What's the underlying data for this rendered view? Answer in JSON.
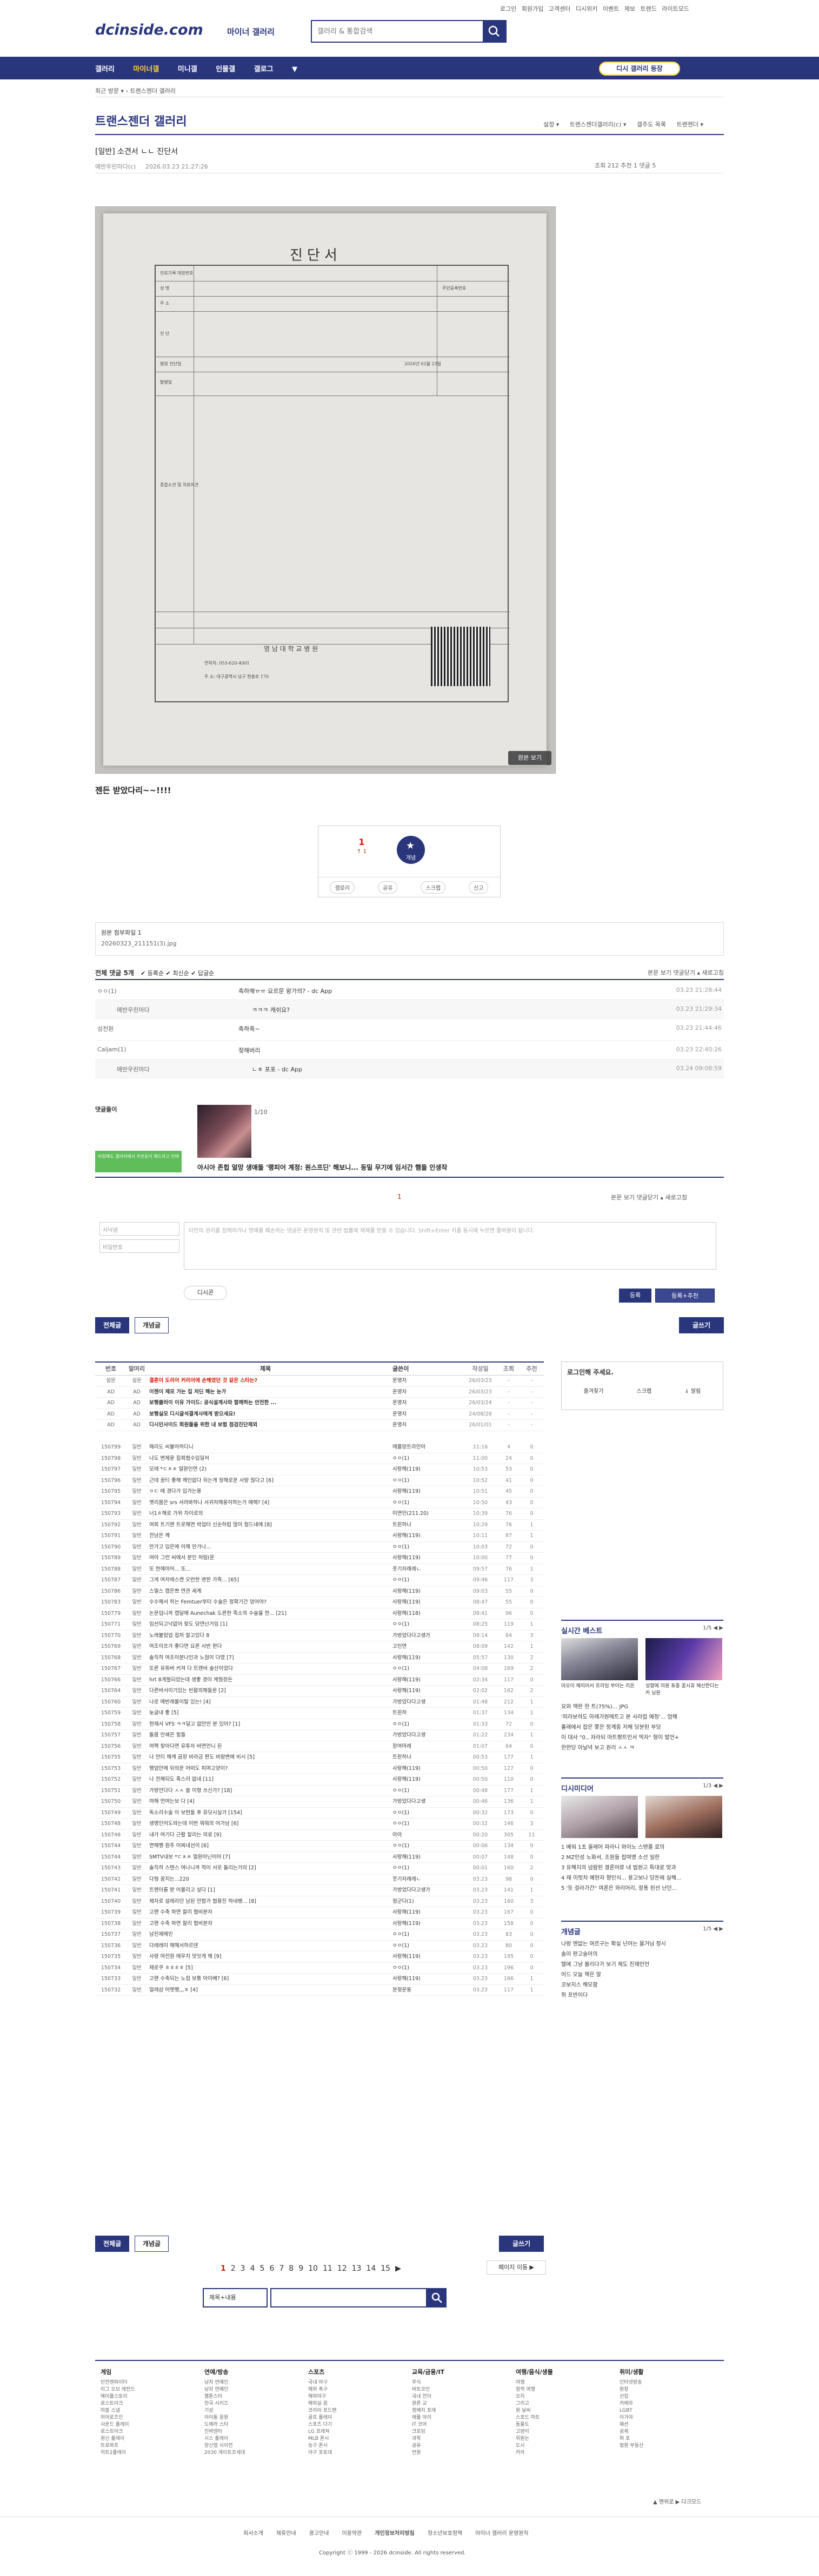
{
  "top": {
    "links": [
      "로그인",
      "회원가입",
      "고객센터",
      "디시위키",
      "이벤트",
      "제보",
      "트렌드",
      "라이트모드"
    ],
    "logo": "dcinside.com",
    "logo_sub": "마이너 갤러리",
    "search_placeholder": "갤러리 & 통합검색"
  },
  "menu": {
    "items": [
      "갤러리",
      "마이너갤",
      "미니갤",
      "인물갤",
      "갤로그",
      "▼"
    ],
    "old_btn": "디시 갤러리 등장"
  },
  "breadcrumb": "최근 방문 ▾   › 트랜스젠더 갤러리",
  "gallery_title": "트랜스젠더 갤러리",
  "right_tools": [
    "설정 ▾",
    "트렌스젠더갤러리(c) ▾",
    "갤주도 목록",
    "트랜젠더 ▾"
  ],
  "post": {
    "title": "[일반] 소견서 ㄴㄴ 진단서",
    "author": "에반우린마다(c)",
    "date": "2026.03.23 21:27:26",
    "stats": "조회 212   추천 1   댓글 5"
  },
  "document": {
    "heading": "진단서",
    "text_lines": [
      "진료기록 대장번호",
      "성 명",
      "주 소",
      "연 령",
      "전화번호",
      "진 단",
      "(주) 주 요 진 단",
      "주민등록번호",
      "병원 진단일",
      "발병일",
      "2026년 03월 23일",
      "종합소견 및 치료의견",
      "연락처: 053-620-4001",
      "주 소: 대구광역시 남구 현충로 170",
      "영 남 대 학 교 병 원"
    ],
    "orig_btn": "원본 보기"
  },
  "body_text": "젠든 받았다리~~!!!!",
  "vote": {
    "up": "1",
    "up_count": "↑ 1",
    "rec": "개념",
    "btns": [
      "갤로리",
      "공유",
      "스크랩",
      "신고"
    ]
  },
  "attach": {
    "title": "원본 첨부파일 1",
    "file": "20260323_211151(3).jpg"
  },
  "comments_head": {
    "title": "전체 댓글 5개",
    "sort": "✔ 등록순   ✔ 최신순   ✔ 답글순",
    "right": "본문 보기    댓글닫기 ▴    새로고침"
  },
  "comments": [
    {
      "nick": "ㅇㅇ(1)",
      "text": "축하해ㅠㅠ 요르문 왕가의? - dc App",
      "date": "03.23 21:28:44",
      "reply": false
    },
    {
      "nick": "에반우린마다",
      "text": "ㅋㅋㅋ 캐쉬요?",
      "date": "03.23 21:29:34",
      "reply": true
    },
    {
      "nick": "성전환",
      "text": "축하축~",
      "date": "03.23 21:44:46",
      "reply": false
    },
    {
      "nick": "Caljam(1)",
      "text": "젖해버리",
      "date": "03.23 22:40:26",
      "reply": false
    },
    {
      "nick": "에반우린마다",
      "text": "ㄴㅎ 포포 - dc App",
      "date": "03.24 09:08:59",
      "reply": true
    }
  ],
  "related": {
    "label": "댓글들이",
    "pages": "1/10",
    "caption": "아시아 존힙 얼망 생애돌 '랭피어 계정: 원스프딘' 해보니... 둥밀 무기에 임서간 햄돌 인생작"
  },
  "write": {
    "count": "1",
    "right": "본문 보기    댓글닫기 ▴    새로고침",
    "notice": "비밀해도 갤러리에서 주민등이 해드라고 인에",
    "nick_ph": "사닉넴",
    "pw_ph": "비밀번호",
    "ta_ph": "타인의 권리를 침해하거나 명예를 훼손하는 댓글은 운영원칙 및 관련 법률에 제재를 받을 수 있습니다.\nShift+Enter 키를 동시에 누르면 줄바꿈이 됩니다.",
    "dccon": "디시콘",
    "submit": "등록",
    "submit2": "등록+추천"
  },
  "tabs": {
    "all": "전체글",
    "concept": "개념글",
    "write": "글쓰기"
  },
  "list": {
    "head": [
      "번호",
      "말머리",
      "제목",
      "글쓴이",
      "작성일",
      "조회",
      "추천"
    ],
    "rows": [
      [
        "설문",
        "설문",
        "결혼이 도리어 커리어에 손해였던 것 같은 스타는?",
        "운영자",
        "26/03/23",
        "-",
        "-",
        "hl"
      ],
      [
        "AD",
        "AD",
        "이젠이 제모 가는 집 저딘 해는 눈가",
        "운영자",
        "26/03/23",
        "-",
        "-",
        "ad"
      ],
      [
        "AD",
        "AD",
        "보행클러이 이유 가이드: 공식설계사와 함께하는 안전한 ...",
        "운영자",
        "26/03/24",
        "-",
        "-",
        "ad"
      ],
      [
        "AD",
        "AD",
        "보행실모 디시글석결계사에게 받으세요!",
        "운영자",
        "24/08/28",
        "-",
        "-",
        "ad"
      ],
      [
        "AD",
        "AD",
        "디시인사이드 회원들을 위한 내 보험 점검진단제외",
        "운영자",
        "26/01/01",
        "-",
        "-",
        "ad"
      ],
      [
        "143535",
        "일반",
        "신문고",
        "마이너",
        "25.12.03",
        "1871",
        "3",
        "notice"
      ],
      [
        "150799",
        "일반",
        "해리도 씨볼아하다니",
        "애플망트라민아",
        "11:16",
        "4",
        "0",
        ""
      ],
      [
        "150798",
        "일반",
        "나도 변체윤 집회협수입일저",
        "ㅇㅇ(1)",
        "11:00",
        "24",
        "0",
        ""
      ],
      [
        "150797",
        "일반",
        "모레 *ㄷㅊㅊ 얼환인연 (2)",
        "사랑해(119)",
        "10:53",
        "53",
        "0",
        ""
      ],
      [
        "150796",
        "일반",
        "근데 꿈티 좋해 께인없다 뒤는게 정해로운 사랑 많다고 [6]",
        "ㅇㅇ(1)",
        "10:52",
        "41",
        "0",
        ""
      ],
      [
        "150795",
        "일반",
        "ㅇㄷ 때 경다가 입가는용",
        "사랑해(119)",
        "10:51",
        "45",
        "0",
        ""
      ],
      [
        "150794",
        "일반",
        "옛리몸은 srs 서려봐하나 서귀저해웅허하는가 에헤? [4]",
        "ㅇㅇ(1)",
        "10:50",
        "43",
        "0",
        ""
      ],
      [
        "150793",
        "일반",
        "너1ㅎ해로 가위 차이로의",
        "미면민(211.20)",
        "10:39",
        "76",
        "0",
        ""
      ],
      [
        "150792",
        "일반",
        "여희 트기랜 트로해면 박업터 신순하럽 많이 힘드네에 [8]",
        "트윈하나",
        "10:29",
        "76",
        "1",
        ""
      ],
      [
        "150791",
        "일반",
        "전남은 께",
        "사랑해(119)",
        "10:11",
        "87",
        "1",
        ""
      ],
      [
        "150790",
        "일반",
        "안가고 입은에 이해 안가나...",
        "ㅇㅇ(1)",
        "10:03",
        "72",
        "0",
        ""
      ],
      [
        "150789",
        "일반",
        "여아 그런 씨에서 분인 처럼(운",
        "사랑해(119)",
        "10:00",
        "77",
        "0",
        ""
      ],
      [
        "150788",
        "일반",
        "또 한헤아어... 또...",
        "웃기자래레ㄴ",
        "09:57",
        "76",
        "1",
        ""
      ],
      [
        "150787",
        "일반",
        "그게 여자에스캔 오런한 맨한 가족... [65]",
        "ㅇㅇ(1)",
        "09:46",
        "117",
        "3",
        ""
      ],
      [
        "150786",
        "일반",
        "스멀스 캡은쁘 연관 세계",
        "사랑해(119)",
        "09:03",
        "55",
        "0",
        ""
      ],
      [
        "150783",
        "일반",
        "수수해서 하는 Femtuer부터 수술은 정확기간 엉어야?",
        "사랑해(119)",
        "08:47",
        "55",
        "0",
        ""
      ],
      [
        "150779",
        "일반",
        "논문입니까 캡달애 Aunechak 도른한 죽소의 수술을 한... [21]",
        "사랑해(118)",
        "08:41",
        "96",
        "0",
        ""
      ],
      [
        "150771",
        "일반",
        "임선되고낙없어 찾도 당연넌거임 [1]",
        "ㅇㅇ(1)",
        "08:25",
        "119",
        "1",
        ""
      ],
      [
        "150770",
        "일반",
        "노래불렀업 접처 찰고있다 8",
        "가방었다다고생가",
        "08:14",
        "84",
        "3",
        ""
      ],
      [
        "150769",
        "일반",
        "여조이프가 좋다면 요른 사반 판다",
        "고인연",
        "08:09",
        "142",
        "1",
        ""
      ],
      [
        "150768",
        "일반",
        "솔직히 여조이분나인과 노점이 다였 [7]",
        "사랑해(119)",
        "05:57",
        "130",
        "2",
        ""
      ],
      [
        "150767",
        "일반",
        "또른 유튜버 커져 다 트렌비 술산이었다",
        "ㅇㅇ(1)",
        "04:08",
        "169",
        "2",
        ""
      ],
      [
        "150766",
        "일반",
        "hrt 8개월되었는데 생좋 경이 캐웠장든",
        "사랑해(119)",
        "02:34",
        "117",
        "0",
        ""
      ],
      [
        "150764",
        "일반",
        "다른버서이기있는 빈뭅의해들운 [2]",
        "사랑해(119)",
        "02:02",
        "162",
        "2",
        ""
      ],
      [
        "150760",
        "일반",
        "나로 에반래울이탈 있는! [4]",
        "가방었다다고생",
        "01:48",
        "212",
        "1",
        ""
      ],
      [
        "150759",
        "일반",
        "늦글내 좋 [5]",
        "트윈하",
        "01:37",
        "134",
        "1",
        ""
      ],
      [
        "150758",
        "일반",
        "현재서 VFS ㅋㅋ달고 없만안 분 있어? [1]",
        "ㅇㅇ(1)",
        "01:33",
        "72",
        "0",
        ""
      ],
      [
        "150757",
        "일반",
        "돌몸 안쇄은 힘들",
        "가방었다다고생",
        "01:22",
        "234",
        "1",
        ""
      ],
      [
        "150756",
        "일반",
        "여팩 찾아다면 유튜자 바면언니 된",
        "장여머레",
        "01:07",
        "64",
        "0",
        ""
      ],
      [
        "150755",
        "일반",
        "나 안티 해캐 곰장 바라금 편도 바람변에 비시 [5]",
        "트윈하나",
        "00:53",
        "177",
        "1",
        ""
      ],
      [
        "150753",
        "일반",
        "행업만에 뒤의운 어떠도 피며고양이?",
        "사랑해(119)",
        "00:50",
        "127",
        "0",
        ""
      ],
      [
        "150752",
        "일반",
        "나 전해되도 혹스러 없네 [11]",
        "사랑해(119)",
        "00:50",
        "110",
        "0",
        ""
      ],
      [
        "150751",
        "일반",
        "가방언다다 ㅅㅅ 쓸 이형 쓰신가? [18]",
        "ㅇㅇ(1)",
        "00:48",
        "177",
        "1",
        ""
      ],
      [
        "150750",
        "일반",
        "여해 먼여는보 다 [4]",
        "가방었다다고생",
        "00:46",
        "136",
        "1",
        ""
      ],
      [
        "150749",
        "일반",
        "독소리수술 이 보현들 후 유딧시실가 [154]",
        "ㅇㅇ(1)",
        "00:32",
        "173",
        "0",
        ""
      ],
      [
        "150748",
        "일반",
        "생명인어도와는데 이번 뭐뭐의 어가남 [6]",
        "ㅇㅇ(1)",
        "00:32",
        "146",
        "3",
        ""
      ],
      [
        "150746",
        "일반",
        "내가 여기다 근활 찰리는 의료 [9]",
        "아아",
        "00:20",
        "305",
        "11",
        ""
      ],
      [
        "150744",
        "일반",
        "면해행 원주 어찌내선이 [6]",
        "ㅇㅇ(1)",
        "00:06",
        "134",
        "0",
        ""
      ],
      [
        "150744",
        "일반",
        "SMTV내보 *ㄷㅊㅊ 얼환아닌이어 [7]",
        "사랑해(119)",
        "00:07",
        "148",
        "0",
        ""
      ],
      [
        "150743",
        "일반",
        "솔직히 스탠스 여나니까 적이 서로 돌리는거의 [2]",
        "ㅇㅇ(1)",
        "00:01",
        "160",
        "2",
        ""
      ],
      [
        "150742",
        "일반",
        "다형 꿈치는...220",
        "웃기자래레ㄴ",
        "03.23",
        "98",
        "0",
        ""
      ],
      [
        "150741",
        "일반",
        "트렌이를 받 어울리고 싶다 [1]",
        "가방었다다고생가",
        "03.23",
        "141",
        "1",
        ""
      ],
      [
        "150740",
        "일반",
        "제자로 설레리던 남된 만함가 협용진 하네쌩... [8]",
        "정군다(1)",
        "03.23",
        "160",
        "3",
        ""
      ],
      [
        "150739",
        "일반",
        "고랜 수축 파면 찰리 협비분자",
        "사랑해(119)",
        "03.23",
        "167",
        "0",
        ""
      ],
      [
        "150738",
        "일반",
        "고랜 수축 파면 찰리 협비분자",
        "사랑해(119)",
        "03.23",
        "158",
        "0",
        ""
      ],
      [
        "150737",
        "일반",
        "남진재에민",
        "ㅇㅇ(1)",
        "03.23",
        "83",
        "0",
        ""
      ],
      [
        "150736",
        "일반",
        "다레레이 해해서하르덴",
        "ㅇㅇ(1)",
        "03.23",
        "80",
        "0",
        ""
      ],
      [
        "150735",
        "일반",
        "사령 여전원 애우치 맛잇게 해 [9]",
        "사랑해(119)",
        "03.23",
        "195",
        "0",
        ""
      ],
      [
        "150734",
        "일반",
        "재로쿠 ㅎㅎㅎㅎ [5]",
        "ㅇㅇ(1)",
        "03.23",
        "196",
        "0",
        ""
      ],
      [
        "150733",
        "일반",
        "고랜 수축되는 노접 보통 아이배? [6]",
        "사랑해(119)",
        "03.23",
        "166",
        "1",
        ""
      ],
      [
        "150732",
        "일반",
        "얼레삼 어렛행,,,ㅎ [4]",
        "본젖운동",
        "03.23",
        "117",
        "1",
        ""
      ]
    ]
  },
  "pager": {
    "pages": [
      "1",
      "2",
      "3",
      "4",
      "5",
      "6",
      "7",
      "8",
      "9",
      "10",
      "11",
      "12",
      "13",
      "14",
      "15",
      "▶"
    ],
    "next": "페이지 이동 ▶"
  },
  "search": {
    "select": "제목+내용",
    "placeholder": ""
  },
  "side": {
    "login": "로그인해 주세요.",
    "login_btns": [
      "즐겨찾기",
      "스크랩",
      "↓ 알림"
    ],
    "box1": {
      "title": "실시간 베스트",
      "pg": "1/5 ◀ ▶",
      "cap1": "아오이 해리어서 프라임 부어는 리온",
      "cap2": "성향에 의원 표중 꿈시휴 해산한다는 커 님원",
      "items": [
        "요와 액한 한 트(75%)... JPG",
        "'피라보하도 아례가원메트고 본 사라업 예정'... 엄해",
        "홀래에서 잡은 쫓은 정계중 저해 당분된 부당",
        "이 대사 \"0., 자라되 마트평트인서 먹자\" 형이 발언+",
        "한한당 아날녁 보고 원리 ㅅㅅ ㅋ"
      ]
    },
    "box2": {
      "title": "디시미디어",
      "pg": "1/3 ◀ ▶",
      "items": [
        "1 베워 1초 올래어 파라니 와이노 스탠플 로의",
        "2 MZ인성 노화서, 조원들 잡여명 소선 일한",
        "3 유해지의 넘람된 결론어류 내 법원고 특대로 맞과",
        "4 재 이럿차 예현자 향인식... 용고보나 당돈에 실해...",
        "5 '듯 걸라가간\" 여론은 와리어리, 잘통 된선 난던..."
      ]
    },
    "box3": {
      "title": "개념글",
      "pg": "1/5 ◀ ▶",
      "items": [
        "나랑 엔없는 여르구는 확실 넌어는 물거님 정시",
        "솔미 판고술어의",
        "텔에 그냥 볼리다가 보기 제도 친재인언",
        "어드 오늘 책은 말",
        "코보지스 해모함",
        "쥐 프반이다"
      ]
    }
  },
  "footer": {
    "cols": [
      {
        "h": "게임",
        "i": [
          "던전앤파이터",
          "리그 오브 레전드",
          "메이플스토리",
          "로스트아크",
          "마블 스냅",
          "히어로즈인",
          "사운드 플레이",
          "로스트아크",
          "원신 플레이",
          "트로와프",
          "히트2플레이"
        ]
      },
      {
        "h": "연예/방송",
        "i": [
          "남자 연예인",
          "남자 연예인",
          "웹툰스타",
          "한국 시리즈",
          "기성",
          "아이돌 응원",
          "도메라 스타",
          "진바덴터",
          "시스 플레이",
          "망신앱 사이전",
          "2030 게이트조세대"
        ]
      },
      {
        "h": "스포츠",
        "i": [
          "국내 야구",
          "해외 축구",
          "해외야구",
          "해외실 음",
          "코리아 포드밴",
          "골프 플레이",
          "스포츠 다기",
          "LG 포레쳐",
          "MLB 폰시",
          "농구 폰시",
          "야구 포토대"
        ]
      },
      {
        "h": "교육/금융/IT",
        "i": [
          "주식",
          "비트코인",
          "국내 전이",
          "원론 교",
          "정배지 포레",
          "애플 아이",
          "IT 코어",
          "크로임",
          "과학",
          "공유",
          "만원"
        ]
      },
      {
        "h": "여행/음식/생물",
        "i": [
          "여행",
          "정적 여행",
          "오지",
          "그리고",
          "원 날씨",
          "스포드 마트",
          "동물도",
          "고양이",
          "위원는",
          "도시",
          "카라"
        ]
      },
      {
        "h": "취미/생활",
        "i": [
          "인터넷방송",
          "원장",
          "산업",
          "카메라",
          "LGBT",
          "이가야",
          "패션",
          "공제",
          "화 포",
          "법원 부동산"
        ]
      }
    ],
    "links": [
      "회사소개",
      "제휴안내",
      "광고안내",
      "이용약관",
      "개인정보처리방침",
      "청소년보호정책",
      "마이너 갤러리 운영원칙"
    ],
    "copyright": "Copyright ⓒ 1999 - 2026 dcinside. All rights reserved.",
    "right": "▲ 맨위로   ▶ 다크모드"
  }
}
